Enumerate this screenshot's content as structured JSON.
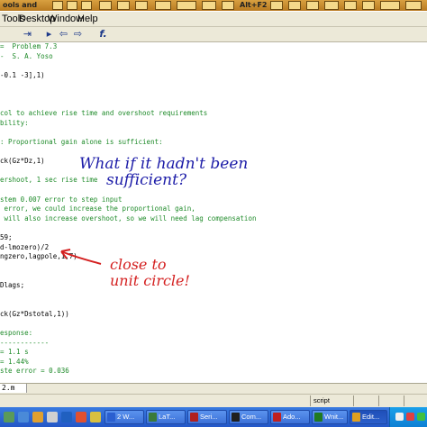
{
  "topstrip": {
    "label_1": "ools and ",
    "label_2": "Alt+F2"
  },
  "menubar": {
    "items": [
      "Tools",
      "Desktop",
      "Window",
      "Help"
    ]
  },
  "toolbar": {
    "buttons": [
      {
        "name": "cell-mode-icon",
        "glyph": "⇥"
      },
      {
        "name": "run-icon",
        "glyph": "▸"
      },
      {
        "name": "back-icon",
        "glyph": "⇦"
      },
      {
        "name": "forward-icon",
        "glyph": "⇨"
      },
      {
        "name": "function-icon",
        "glyph": "f."
      }
    ]
  },
  "editor": {
    "lines": [
      {
        "text": "=  Problem 7.3",
        "kind": "comment"
      },
      {
        "text": "-  S. A. Yoso",
        "kind": "comment"
      },
      {
        "text": "",
        "kind": "code"
      },
      {
        "text": "-0.1 -3],1)",
        "kind": "code"
      },
      {
        "text": "",
        "kind": "code"
      },
      {
        "text": "",
        "kind": "code"
      },
      {
        "text": "",
        "kind": "code"
      },
      {
        "text": "col to achieve rise time and overshoot requirements",
        "kind": "comment"
      },
      {
        "text": "bility:",
        "kind": "comment"
      },
      {
        "text": "",
        "kind": "code"
      },
      {
        "text": ": Proportional gain alone is sufficient:",
        "kind": "comment"
      },
      {
        "text": "",
        "kind": "code"
      },
      {
        "text": "ck(Gz*Dz,1)",
        "kind": "code"
      },
      {
        "text": "",
        "kind": "code"
      },
      {
        "text": "ershoot, 1 sec rise time",
        "kind": "comment"
      },
      {
        "text": "",
        "kind": "code"
      },
      {
        "text": "stem 0.007 error to step input",
        "kind": "comment"
      },
      {
        "text": " error, we could increase the proportional gain,",
        "kind": "comment"
      },
      {
        "text": " will also increase overshoot, so we will need lag compensation",
        "kind": "comment"
      },
      {
        "text": "",
        "kind": "code"
      },
      {
        "text": "59;",
        "kind": "code"
      },
      {
        "text": "d-lmozero)/2",
        "kind": "code"
      },
      {
        "text": "ngzero,lagpole,1,7)",
        "kind": "code"
      },
      {
        "text": "",
        "kind": "code"
      },
      {
        "text": "",
        "kind": "code"
      },
      {
        "text": "Dlags;",
        "kind": "code"
      },
      {
        "text": "",
        "kind": "code"
      },
      {
        "text": "",
        "kind": "code"
      },
      {
        "text": "ck(Gz*Dstotal,1))",
        "kind": "code"
      },
      {
        "text": "",
        "kind": "code"
      },
      {
        "text": "esponse:",
        "kind": "comment"
      },
      {
        "text": "------------",
        "kind": "comment"
      },
      {
        "text": "= 1.1 s",
        "kind": "comment"
      },
      {
        "text": "= 1.44%",
        "kind": "comment"
      },
      {
        "text": "ste error = 0.036",
        "kind": "comment"
      }
    ],
    "annotation_blue_1": "What if it hadn't been",
    "annotation_blue_2": "sufficient?",
    "annotation_red_1": "close to",
    "annotation_red_2": "unit circle!"
  },
  "filetab": {
    "label": "2.m"
  },
  "status": {
    "mode": "script"
  },
  "taskbar": {
    "buttons": [
      {
        "label": "2 W...",
        "color": "#2a5fd0"
      },
      {
        "label": "LaT...",
        "color": "#3a7a3a"
      },
      {
        "label": "Seri...",
        "color": "#b02020"
      },
      {
        "label": "Com...",
        "color": "#202020"
      },
      {
        "label": "Ado...",
        "color": "#c02020"
      },
      {
        "label": "Wnit...",
        "color": "#207a20"
      },
      {
        "label": "Edit...",
        "color": "#e0a020",
        "active": true
      }
    ]
  }
}
